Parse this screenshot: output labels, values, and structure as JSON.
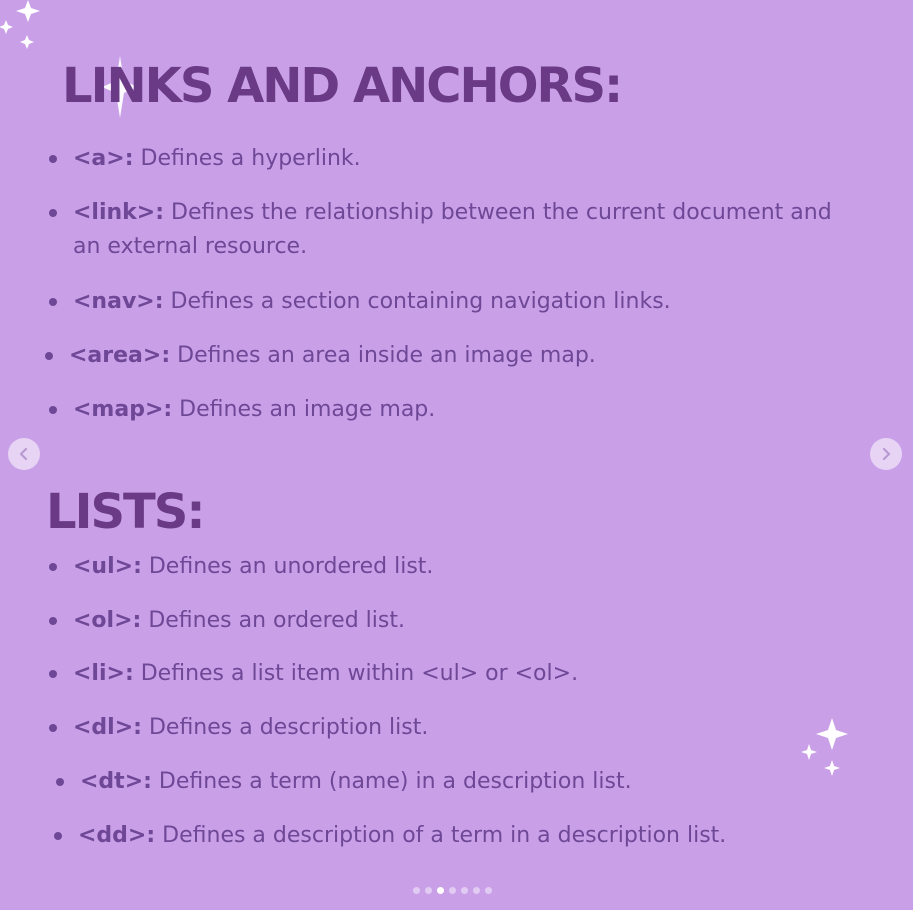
{
  "links_section": {
    "heading": "LINKS AND ANCHORS:",
    "items": [
      {
        "tag": "<a>:",
        "text": " Defines a hyperlink."
      },
      {
        "tag": "<link>:",
        "text": " Defines the relationship between the current document and an external resource."
      },
      {
        "tag": "<nav>:",
        "text": " Defines a section containing navigation links."
      },
      {
        "tag": "<area>:",
        "text": " Defines an area inside an image map."
      },
      {
        "tag": "<map>:",
        "text": " Defines an image map."
      }
    ]
  },
  "lists_section": {
    "heading": "LISTS:",
    "items": [
      {
        "tag": "<ul>:",
        "text": " Defines an unordered list."
      },
      {
        "tag": "<ol>:",
        "text": " Defines an ordered list."
      },
      {
        "tag": "<li>:",
        "text": " Defines a list item within <ul> or <ol>."
      },
      {
        "tag": "<dl>:",
        "text": " Defines a description list."
      },
      {
        "tag": "<dt>:",
        "text": " Defines a term (name) in a description list."
      },
      {
        "tag": "<dd>:",
        "text": " Defines a description of a term in a description list."
      }
    ]
  },
  "carousel": {
    "prev_icon": "chevron-left-icon",
    "next_icon": "chevron-right-icon",
    "slide_count": 7,
    "active_slide": 3
  },
  "colors": {
    "background": "#c9a0e8",
    "heading": "#6a3a86",
    "text": "#6e4796",
    "sparkle": "#ffffff"
  }
}
